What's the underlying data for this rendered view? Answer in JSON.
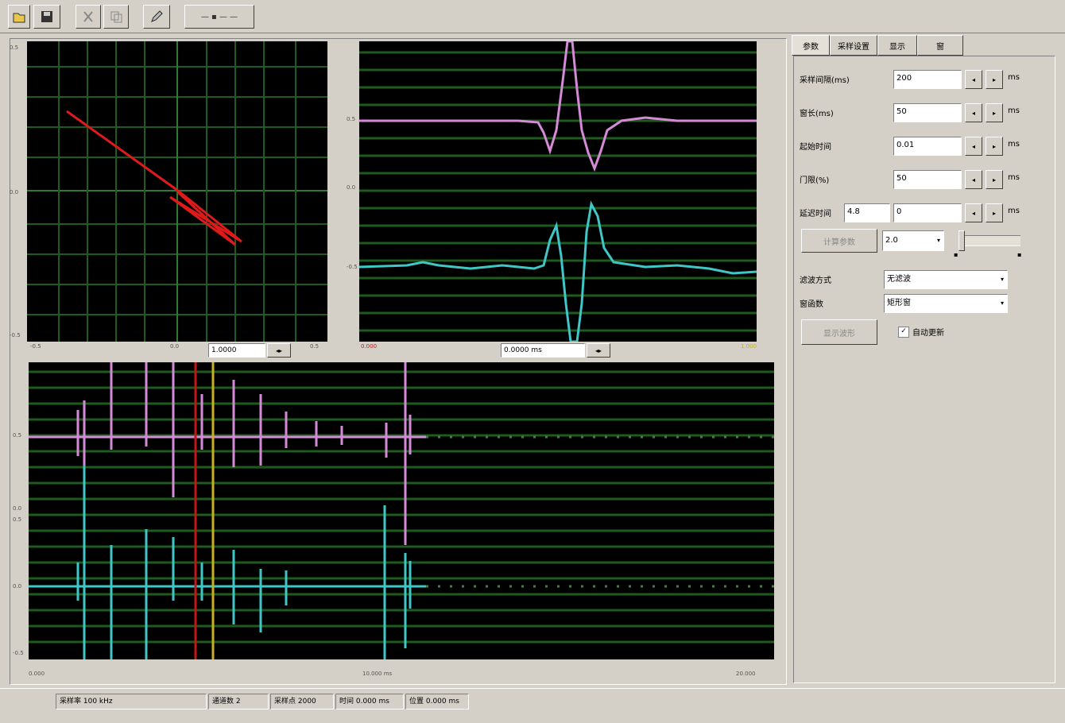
{
  "toolbar": {
    "buttons": [
      {
        "name": "open-button",
        "icon": "open-icon",
        "label": ""
      },
      {
        "name": "save-button",
        "icon": "save-icon",
        "label": ""
      },
      {
        "name": "cut-button",
        "icon": "cut-icon",
        "label": ""
      },
      {
        "name": "copy-button",
        "icon": "copy-icon",
        "label": ""
      },
      {
        "name": "edit-button",
        "icon": "pencil-icon",
        "label": ""
      },
      {
        "name": "zoom-button",
        "icon": "zoom-icon",
        "label": "— ▪ — —"
      }
    ]
  },
  "plots": {
    "xy_plot": {
      "ytick_top": "0.5",
      "ytick_mid": "0.0",
      "ytick_bottom": "-0.5",
      "xtick_left": "-0.5",
      "xtick_mid": "0.0",
      "xtick_right": "0.5",
      "control_value": "1.0000"
    },
    "waveform_plot": {
      "ytick_1": "0.5",
      "ytick_2": "0.0",
      "ytick_3": "-0.5",
      "left_label": "0.000",
      "control_value": "0.0000 ms",
      "right_label": "1.000"
    },
    "timeline_plot": {
      "ytick_1": "0.5",
      "ytick_2": "0.0",
      "ytick_3": "0.5",
      "ytick_4": "0.0",
      "ytick_5": "-0.5",
      "x_left": "0.000",
      "x_mid": "10.000 ms",
      "x_right": "20.000"
    }
  },
  "tabs": [
    "参数",
    "采样设置",
    "显示",
    "窗"
  ],
  "form": {
    "rows": [
      {
        "label": "采样间隔(ms)",
        "value": "200",
        "unit": "ms"
      },
      {
        "label": "窗长(ms)",
        "value": "50",
        "unit": "ms"
      },
      {
        "label": "起始时间",
        "value": "0.01",
        "unit": "ms"
      },
      {
        "label": "门限(%)",
        "value": "50",
        "unit": "ms"
      },
      {
        "label": "延迟时间",
        "value": "0",
        "unit": "ms"
      }
    ],
    "delay_box_value": "4.8",
    "apply_button": "计算参数",
    "combo_small_value": "2.0",
    "dropdown1_label": "滤波方式",
    "dropdown1_value": "无滤波",
    "dropdown2_label": "窗函数",
    "dropdown2_value": "矩形窗",
    "action_button": "显示波形",
    "checkbox_label": "自动更新",
    "checkbox_checked": true
  },
  "status": {
    "segments": [
      "采样率 100 kHz",
      "通道数 2",
      "采样点 2000",
      "时间 0.000 ms",
      "位置 0.000 ms"
    ]
  },
  "colors": {
    "trace_magenta": "#d58ad8",
    "trace_cyan": "#3fc6c6",
    "vector_red": "#e01a1a",
    "grid_green": "#1f5a1f",
    "cursor_red": "#c01818",
    "cursor_yellow": "#c9b023"
  }
}
